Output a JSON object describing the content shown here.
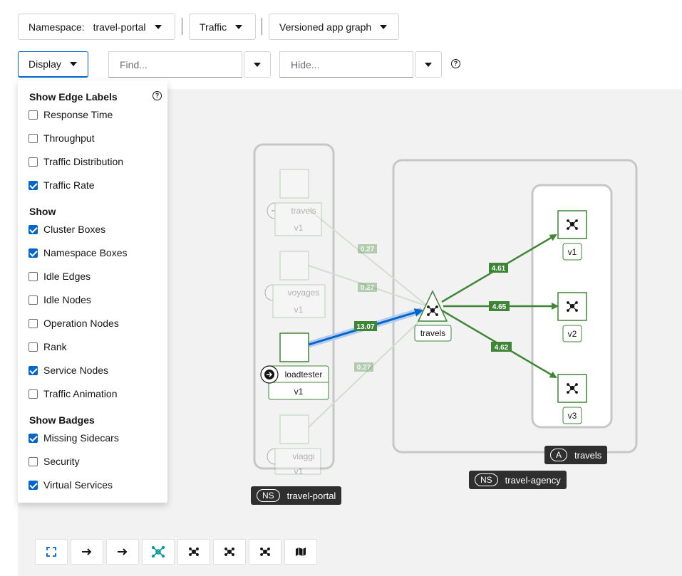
{
  "toolbar": {
    "namespace_label": "Namespace:",
    "namespace_value": "travel-portal",
    "traffic_label": "Traffic",
    "graph_type_label": "Versioned app graph",
    "display_label": "Display",
    "find_placeholder": "Find...",
    "hide_placeholder": "Hide..."
  },
  "display_menu": {
    "groups": [
      {
        "title": "Show Edge Labels",
        "items": [
          {
            "label": "Response Time",
            "checked": false
          },
          {
            "label": "Throughput",
            "checked": false
          },
          {
            "label": "Traffic Distribution",
            "checked": false
          },
          {
            "label": "Traffic Rate",
            "checked": true
          }
        ]
      },
      {
        "title": "Show",
        "items": [
          {
            "label": "Cluster Boxes",
            "checked": true
          },
          {
            "label": "Namespace Boxes",
            "checked": true
          },
          {
            "label": "Idle Edges",
            "checked": false
          },
          {
            "label": "Idle Nodes",
            "checked": false
          },
          {
            "label": "Operation Nodes",
            "checked": false
          },
          {
            "label": "Rank",
            "checked": false
          },
          {
            "label": "Service Nodes",
            "checked": true
          },
          {
            "label": "Traffic Animation",
            "checked": false
          }
        ]
      },
      {
        "title": "Show Badges",
        "items": [
          {
            "label": "Missing Sidecars",
            "checked": true
          },
          {
            "label": "Security",
            "checked": false
          },
          {
            "label": "Virtual Services",
            "checked": true
          }
        ]
      }
    ]
  },
  "graph": {
    "nodes": {
      "travels_dim": "travels",
      "travels_dim_version": "v1",
      "voyages": "voyages",
      "voyages_version": "v1",
      "loadtester": "loadtester",
      "loadtester_version": "v1",
      "viaggi": "viaggi",
      "viaggi_version": "v1",
      "travels_service": "travels",
      "v1": "v1",
      "v2": "v2",
      "v3": "v3"
    },
    "edges": {
      "travels_dim": "0.27",
      "voyages": "0.27",
      "loadtester": "13.07",
      "viaggi": "0.27",
      "to_v1": "4.61",
      "to_v2": "4.65",
      "to_v3": "4.62"
    },
    "boxes": {
      "app_badge": "A",
      "app_name": "travels",
      "ns1_badge": "NS",
      "ns1_name": "travel-agency",
      "ns2_badge": "NS",
      "ns2_name": "travel-portal"
    },
    "colors": {
      "healthy_edge": "#3e8635",
      "selected_edge": "#0066cc",
      "idle": "#d2d2d2"
    }
  },
  "bottom_toolbar": [
    "expand-icon",
    "arrow-right-icon",
    "arrow-right-icon",
    "topology-icon",
    "topology-icon",
    "topology-icon",
    "topology-icon",
    "map-icon"
  ]
}
